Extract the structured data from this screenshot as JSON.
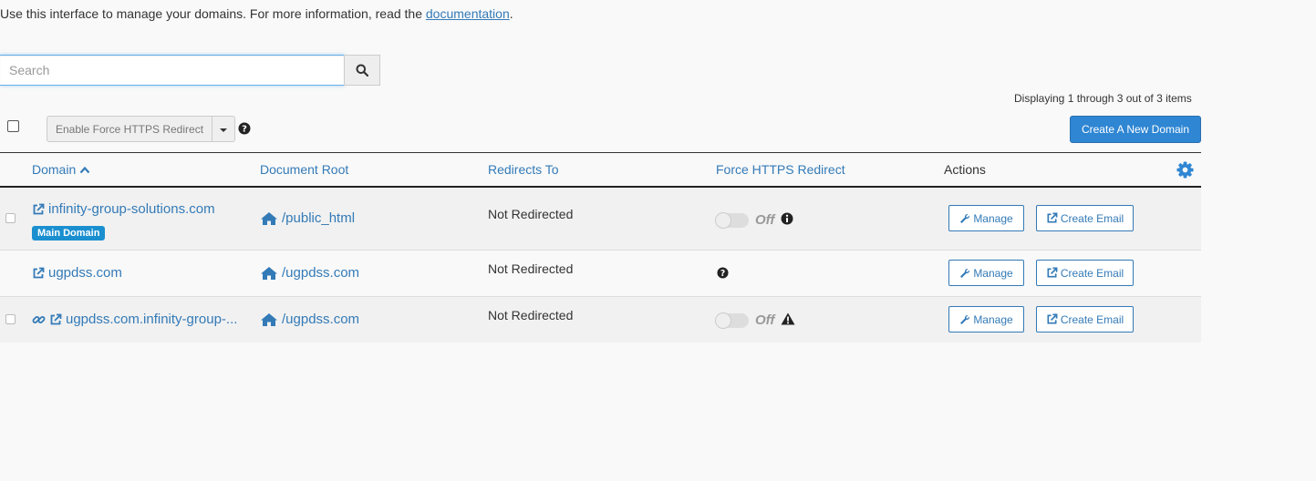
{
  "intro": {
    "text": "Use this interface to manage your domains. For more information, read the ",
    "link": "documentation",
    "end": "."
  },
  "search": {
    "placeholder": "Search",
    "value": "",
    "button_icon": "search-icon"
  },
  "pagination": {
    "display_text": "Displaying 1 through 3 out of 3 items"
  },
  "toolbar": {
    "bulk_action_label": "Enable Force HTTPS Redirect",
    "create_domain_label": "Create A New Domain"
  },
  "table": {
    "headers": {
      "domain": "Domain",
      "document_root": "Document Root",
      "redirects_to": "Redirects To",
      "force_https": "Force HTTPS Redirect",
      "actions": "Actions"
    },
    "rows": [
      {
        "domain": "infinity-group-solutions.com",
        "badge": "Main Domain",
        "document_root": "/public_html",
        "redirects_to": "Not Redirected",
        "https_state": "Off",
        "https_indicator": "info-circle-icon",
        "manage_label": "Manage",
        "create_email_label": "Create Email"
      },
      {
        "domain": "ugpdss.com",
        "document_root": "/ugpdss.com",
        "redirects_to": "Not Redirected",
        "https_indicator": "question-circle-icon",
        "manage_label": "Manage",
        "create_email_label": "Create Email"
      },
      {
        "domain": "ugpdss.com.infinity-group-...",
        "document_root": "/ugpdss.com",
        "redirects_to": "Not Redirected",
        "https_state": "Off",
        "https_indicator": "warning-triangle-icon",
        "manage_label": "Manage",
        "create_email_label": "Create Email"
      }
    ]
  },
  "colors": {
    "link": "#337ab7",
    "primary_button": "#2f86d3",
    "badge": "#1a8fd0"
  }
}
